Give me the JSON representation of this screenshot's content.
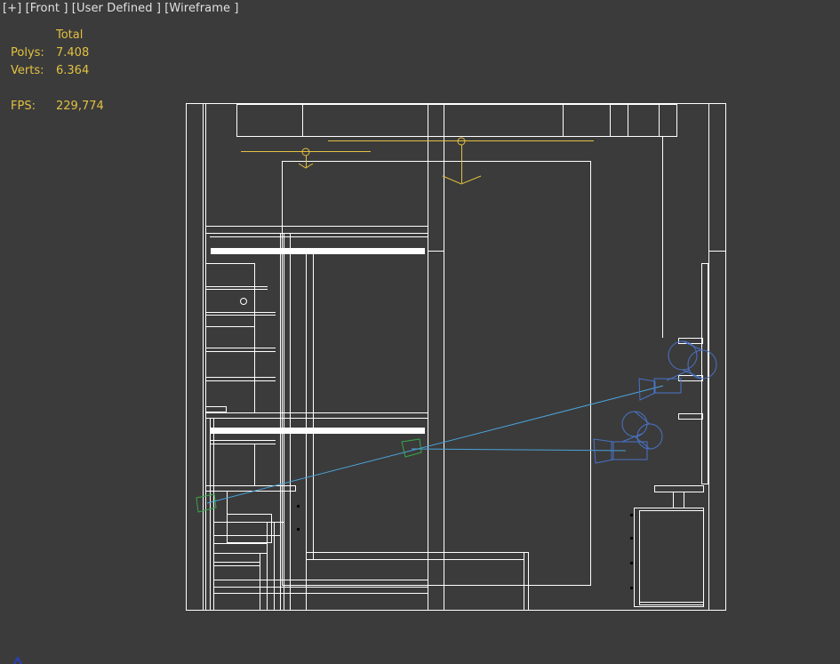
{
  "viewport": {
    "label_plus": "[+]",
    "label_view": "[Front ]",
    "label_mode": "[User Defined ]",
    "label_shading": "[Wireframe ]"
  },
  "stats": {
    "header": "Total",
    "polys_label": "Polys:",
    "polys_value": "7.408",
    "verts_label": "Verts:",
    "verts_value": "6.364",
    "fps_label": "FPS:",
    "fps_value": "229,774"
  },
  "colors": {
    "background": "#3b3b3b",
    "geometry": "#ffffff",
    "lights": "#e2c140",
    "cameras": "#4a73c7",
    "camera_lines": "#4aa3d9",
    "targets": "#3aa64a",
    "stats_text": "#e2c140",
    "label_text": "#e0e0e0"
  },
  "icons": {
    "corner": "axis-tripod-icon"
  }
}
